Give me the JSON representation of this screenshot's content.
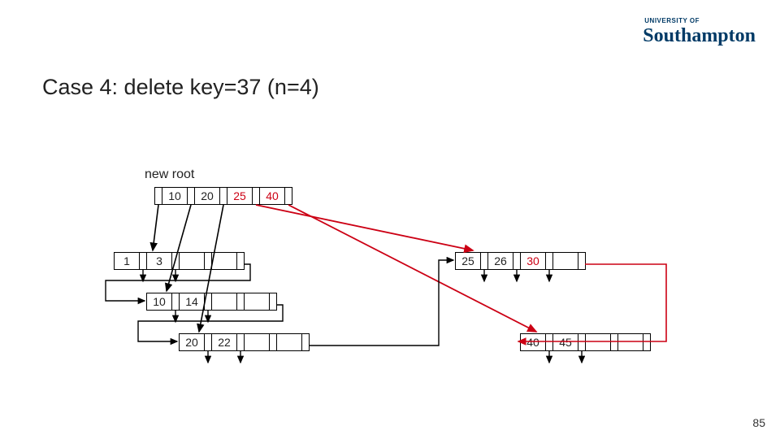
{
  "logo": {
    "prefix": "UNIVERSITY OF",
    "name": "Southampton"
  },
  "title": "Case 4: delete key=37 (n=4)",
  "label_new_root": "new root",
  "page_number": "85",
  "accent_red": "#cc0014",
  "accent_black": "#000000",
  "chart_data": {
    "type": "diagram",
    "structure": "B+ tree after deletion",
    "n": 4,
    "action": "delete key 37",
    "nodes": {
      "root": {
        "keys": [
          10,
          20,
          25,
          40
        ],
        "label": "new root",
        "highlight_keys": [
          25,
          40
        ]
      },
      "leaf_A": {
        "keys": [
          1,
          3
        ]
      },
      "leaf_B": {
        "keys": [
          10,
          14
        ]
      },
      "leaf_C": {
        "keys": [
          20,
          22
        ]
      },
      "leaf_D": {
        "keys": [
          25,
          26,
          30
        ],
        "highlight_keys": [
          30
        ]
      },
      "leaf_E": {
        "keys": [
          40,
          45
        ]
      }
    },
    "root_pointers": [
      {
        "to": "leaf_A",
        "color": "black"
      },
      {
        "to": "leaf_B",
        "color": "black"
      },
      {
        "to": "leaf_C",
        "color": "black"
      },
      {
        "to": "leaf_D",
        "color": "red"
      },
      {
        "to": "leaf_E",
        "color": "red"
      }
    ],
    "leaf_chain": [
      "leaf_A",
      "leaf_B",
      "leaf_C",
      "leaf_D",
      "leaf_E"
    ],
    "leaf_down_arrows_per_node": 2
  }
}
